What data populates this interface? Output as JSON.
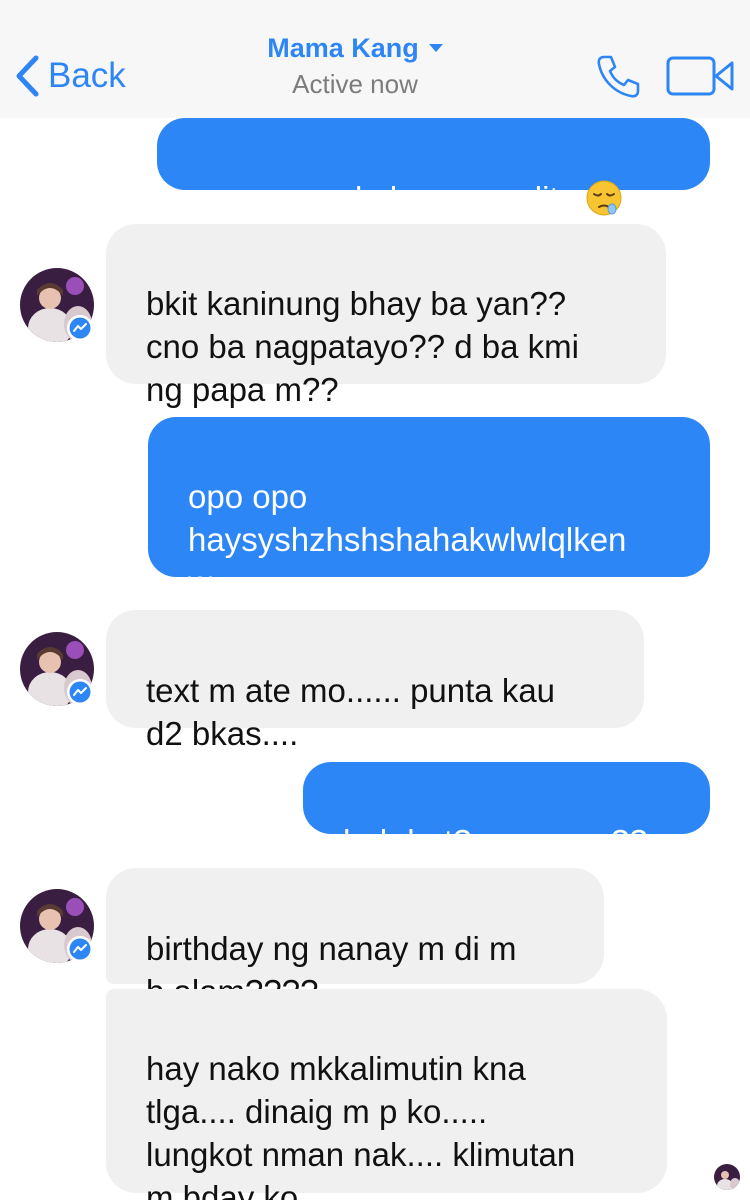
{
  "header": {
    "back_label": "Back",
    "contact_name": "Mama Kang",
    "status": "Active now",
    "icons": [
      "chevron-left-icon",
      "caret-down-icon",
      "phone-icon",
      "video-camera-icon"
    ],
    "accent_color": "#2e86f5"
  },
  "messages": [
    {
      "sender": "me",
      "text": "manggugulo lang yun dito",
      "emoji": "sleepy-face-emoji"
    },
    {
      "sender": "contact",
      "text": "bkit kaninung bhay ba yan??\ncno ba nagpatayo?? d ba kmi\nng papa m??"
    },
    {
      "sender": "me",
      "text": "opo opo\nhaysyshzhshshahakwlwlqlken\nw"
    },
    {
      "sender": "contact",
      "text": "text m ate mo...... punta kau\nd2 bkas...."
    },
    {
      "sender": "me",
      "text": "huh bat? anmeron??"
    },
    {
      "sender": "contact",
      "text": "birthday ng nanay m di m\nb alam????"
    },
    {
      "sender": "contact",
      "text": "hay nako mkkalimutin kna\ntlga.... dinaig m p ko.....\nlungkot nman nak.... klimutan\nm bday ko......."
    }
  ],
  "colors": {
    "outgoing_bubble": "#2d86f6",
    "incoming_bubble": "#f0f0f0",
    "header_background": "#f7f7f7",
    "messenger_badge": "#2e86f5"
  }
}
